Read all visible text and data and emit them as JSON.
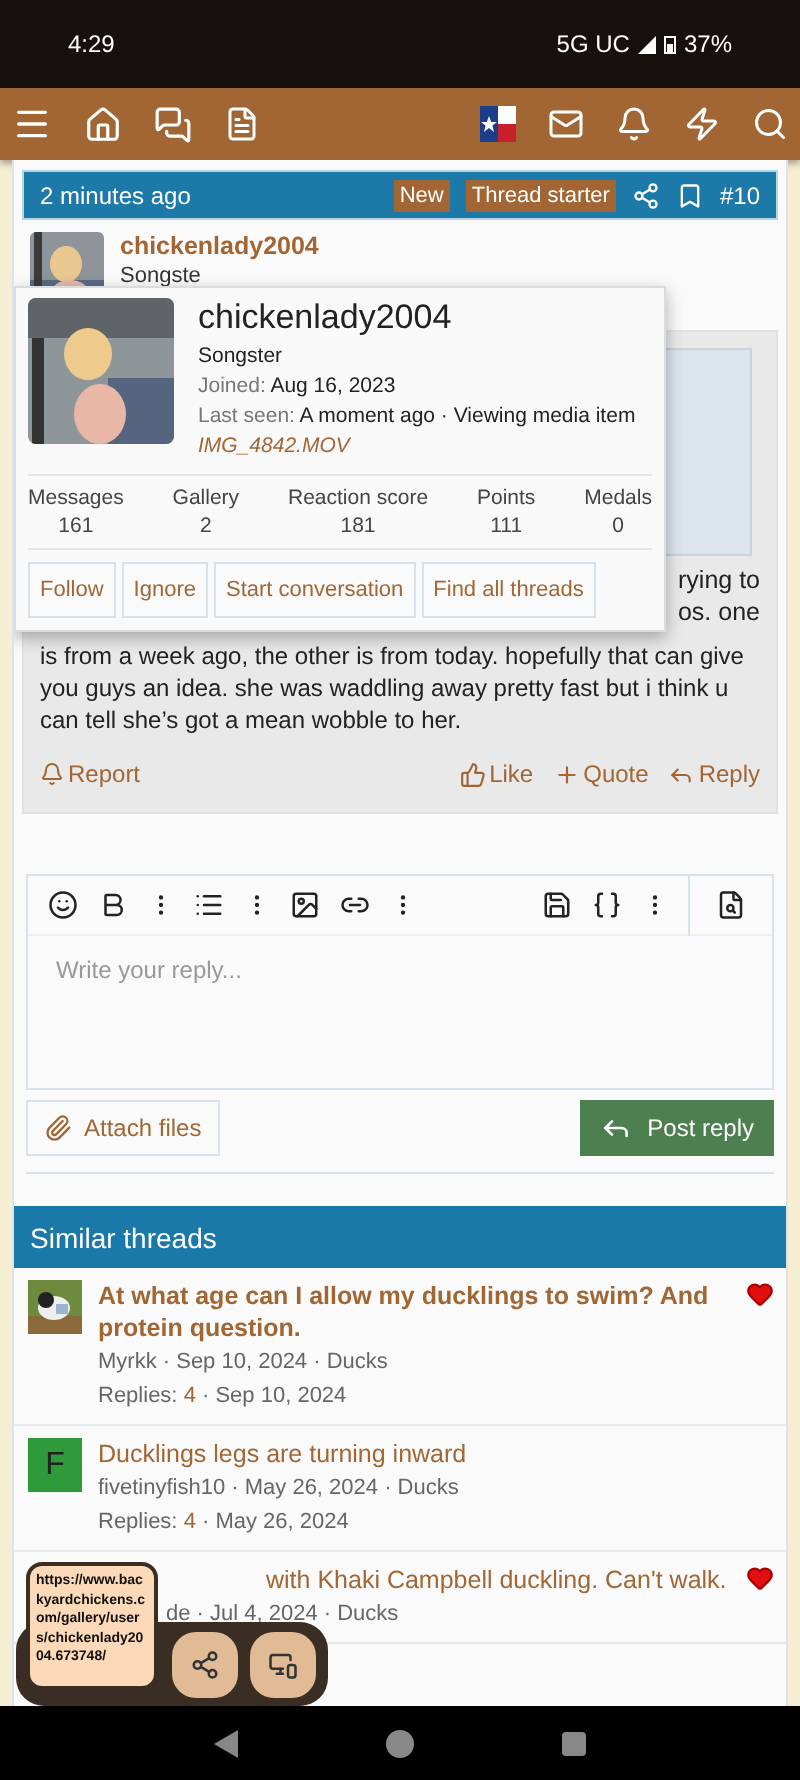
{
  "status_bar": {
    "time": "4:29",
    "network": "5G UC",
    "battery": "37%"
  },
  "post": {
    "time": "2 minutes ago",
    "badges": [
      "New",
      "Thread starter"
    ],
    "number": "#10",
    "author": "chickenlady2004",
    "author_title": "Songste",
    "body_fragments": [
      "rying to",
      "os. one"
    ],
    "body": "is from a week ago, the other is from today. hopefully that can give you guys an idea. she was waddling away pretty fast but i think u can tell she’s got a mean wobble to her.",
    "report": "Report",
    "actions": [
      {
        "kind": "like",
        "label": "Like"
      },
      {
        "kind": "quote",
        "label": "Quote"
      },
      {
        "kind": "reply",
        "label": "Reply"
      }
    ]
  },
  "popup": {
    "username": "chickenlady2004",
    "title": "Songster",
    "joined_label": "Joined:",
    "joined": "Aug 16, 2023",
    "last_seen_label": "Last seen:",
    "last_seen": "A moment ago · Viewing media item",
    "media_link": "IMG_4842.MOV",
    "stats": [
      {
        "label": "Messages",
        "value": "161"
      },
      {
        "label": "Gallery",
        "value": "2"
      },
      {
        "label": "Reaction score",
        "value": "181"
      },
      {
        "label": "Points",
        "value": "111"
      },
      {
        "label": "Medals",
        "value": "0"
      }
    ],
    "buttons": [
      "Follow",
      "Ignore",
      "Start conversation",
      "Find all threads"
    ]
  },
  "editor": {
    "placeholder": "Write your reply...",
    "attach": "Attach files",
    "submit": "Post reply"
  },
  "similar": {
    "title": "Similar threads",
    "threads": [
      {
        "kind": "picture",
        "title": "At what age can I allow my ducklings to swim? And protein question.",
        "meta": "Myrkk · Sep 10, 2024 · Ducks",
        "replies_label": "Replies:",
        "replies": "4",
        "date": "· Sep 10, 2024",
        "liked": true
      },
      {
        "kind": "letter",
        "letter": "F",
        "color": "#2f9a3c",
        "title": "Ducklings legs are turning inward",
        "meta": "fivetinyfish10 · May 26, 2024 · Ducks",
        "replies_label": "Replies:",
        "replies": "4",
        "date": "· May 26, 2024",
        "liked": false
      },
      {
        "kind": "covered",
        "title": "with Khaki Campbell duckling. Can't walk.",
        "meta": "de · Jul 4, 2024 · Ducks",
        "liked": true
      }
    ]
  },
  "link_preview": {
    "url": "https://www.backyardchickens.com/gallery/users/chickenlady2004.673748/"
  }
}
